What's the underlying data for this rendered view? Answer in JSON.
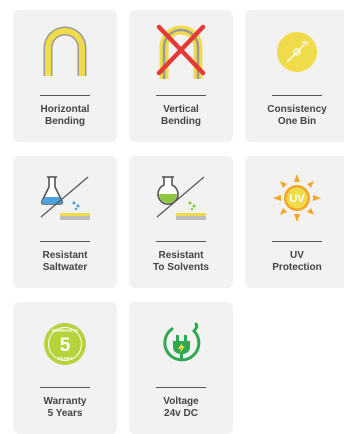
{
  "features": [
    {
      "id": "horizontal-bending",
      "icon": "horizontal-bending-icon",
      "line1": "Horizontal",
      "line2": "Bending"
    },
    {
      "id": "vertical-bending",
      "icon": "vertical-bending-crossed-icon",
      "line1": "Vertical",
      "line2": "Bending"
    },
    {
      "id": "consistency-one-bin",
      "icon": "consistency-circle-icon",
      "line1": "Consistency",
      "line2": "One Bin"
    },
    {
      "id": "resistant-saltwater",
      "icon": "saltwater-flask-icon",
      "line1": "Resistant",
      "line2": "Saltwater"
    },
    {
      "id": "resistant-solvents",
      "icon": "solvent-flask-icon",
      "line1": "Resistant",
      "line2": "To Solvents"
    },
    {
      "id": "uv-protection",
      "icon": "uv-sun-icon",
      "line1": "UV",
      "line2": "Protection",
      "badge": "UV"
    },
    {
      "id": "warranty",
      "icon": "warranty-badge-icon",
      "line1": "Warranty",
      "line2": "5 Years",
      "badge_number": "5",
      "badge_top": "WARRANTY",
      "badge_bottom": "YEARS"
    },
    {
      "id": "voltage",
      "icon": "power-plug-icon",
      "line1": "Voltage",
      "line2": "24v DC"
    }
  ],
  "colors": {
    "card": "#f2f2f2",
    "yellow": "#f0dc4a",
    "green": "#8dc63f",
    "dark_green": "#2fa84f",
    "red": "#e53935",
    "orange": "#f5a623",
    "blue": "#4aa3df",
    "text": "#444444"
  }
}
